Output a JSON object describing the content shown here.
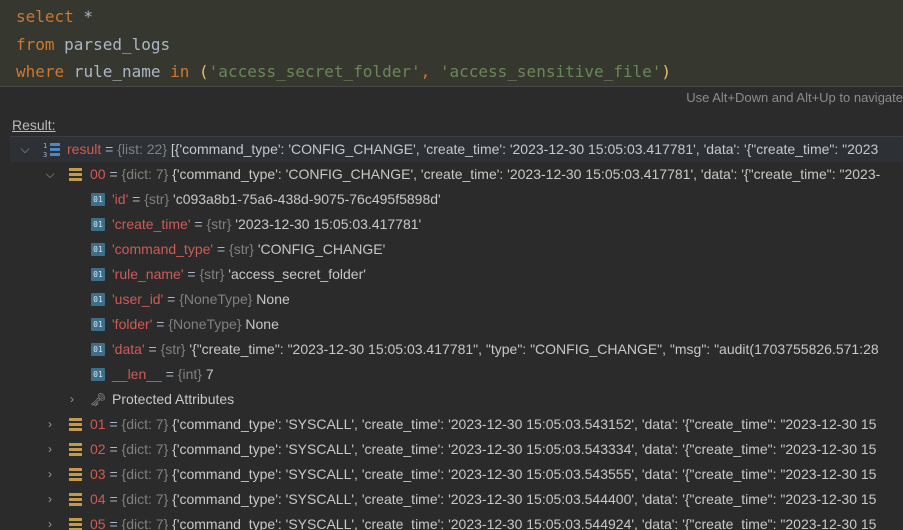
{
  "editor": {
    "line1": {
      "kw": "select",
      "rest": " *"
    },
    "line2": {
      "kw": "from",
      "rest": " parsed_logs"
    },
    "line3": {
      "kw": "where",
      "col": " rule_name ",
      "in": "in",
      "open": " (",
      "s1": "'access_secret_folder'",
      "comma": ", ",
      "s2": "'access_sensitive_file'",
      "close": ")"
    }
  },
  "hint": "Use Alt+Down and Alt+Up to navigate",
  "result_label": "Result:",
  "tree": {
    "root": {
      "name": "result",
      "eq": " = ",
      "type": "{list: 22}",
      "value": " [{'command_type': 'CONFIG_CHANGE', 'create_time': '2023-12-30 15:05:03.417781', 'data': '{\"create_time\": \"2023"
    },
    "item00": {
      "name": "00",
      "eq": " = ",
      "type": "{dict: 7}",
      "value": " {'command_type': 'CONFIG_CHANGE', 'create_time': '2023-12-30 15:05:03.417781', 'data': '{\"create_time\": \"2023-"
    },
    "fields": [
      {
        "name": "'id'",
        "type": "{str}",
        "value": " 'c093a8b1-75a6-438d-9075-76c495f5898d'"
      },
      {
        "name": "'create_time'",
        "type": "{str}",
        "value": " '2023-12-30 15:05:03.417781'"
      },
      {
        "name": "'command_type'",
        "type": "{str}",
        "value": " 'CONFIG_CHANGE'"
      },
      {
        "name": "'rule_name'",
        "type": "{str}",
        "value": " 'access_secret_folder'"
      },
      {
        "name": "'user_id'",
        "type": "{NoneType}",
        "value": " None"
      },
      {
        "name": "'folder'",
        "type": "{NoneType}",
        "value": " None"
      },
      {
        "name": "'data'",
        "type": "{str}",
        "value": " '{\"create_time\": \"2023-12-30 15:05:03.417781\", \"type\": \"CONFIG_CHANGE\", \"msg\": \"audit(1703755826.571:28"
      },
      {
        "name": "__len__",
        "type": "{int}",
        "value": " 7"
      }
    ],
    "protected": "Protected Attributes",
    "items": [
      {
        "name": "01",
        "type": "{dict: 7}",
        "value": " {'command_type': 'SYSCALL', 'create_time': '2023-12-30 15:05:03.543152', 'data': '{\"create_time\": \"2023-12-30 15"
      },
      {
        "name": "02",
        "type": "{dict: 7}",
        "value": " {'command_type': 'SYSCALL', 'create_time': '2023-12-30 15:05:03.543334', 'data': '{\"create_time\": \"2023-12-30 15"
      },
      {
        "name": "03",
        "type": "{dict: 7}",
        "value": " {'command_type': 'SYSCALL', 'create_time': '2023-12-30 15:05:03.543555', 'data': '{\"create_time\": \"2023-12-30 15"
      },
      {
        "name": "04",
        "type": "{dict: 7}",
        "value": " {'command_type': 'SYSCALL', 'create_time': '2023-12-30 15:05:03.544400', 'data': '{\"create_time\": \"2023-12-30 15"
      },
      {
        "name": "05",
        "type": "{dict: 7}",
        "value": " {'command_type': 'SYSCALL', 'create_time': '2023-12-30 15:05:03.544924', 'data': '{\"create_time\": \"2023-12-30 15"
      }
    ]
  },
  "colors": {
    "keyword": "#cc7832",
    "string": "#6a8759",
    "key_name": "#cf5b56",
    "type_hint": "#808080"
  }
}
